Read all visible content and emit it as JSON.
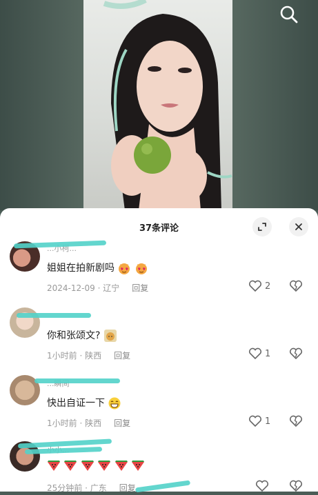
{
  "video": {
    "search_icon": "search-icon"
  },
  "comments_panel": {
    "title": "37条评论",
    "expand_icon": "expand-icon",
    "close_icon": "close-icon",
    "comments": [
      {
        "username": "...小柯...",
        "text": "姐姐在拍新剧吗",
        "emoji": [
          "heart-eyes-cat",
          "heart-eyes-cat"
        ],
        "time": "2024-12-09",
        "location": "辽宁",
        "reply": "回复",
        "likes": "2"
      },
      {
        "username": "",
        "text": "你和张颂文?",
        "emoji": [
          "smug-cat"
        ],
        "time": "1小时前",
        "location": "陕西",
        "reply": "回复",
        "likes": "1"
      },
      {
        "username": "...瞬间",
        "text": "快出自证一下",
        "emoji": [
          "grinning-face"
        ],
        "time": "1小时前",
        "location": "陕西",
        "reply": "回复",
        "likes": "1"
      },
      {
        "username": "小小...",
        "text": "",
        "emoji": [
          "watermelon",
          "watermelon",
          "watermelon",
          "watermelon",
          "watermelon",
          "watermelon"
        ],
        "time": "25分钟前",
        "location": "广东",
        "reply": "回复",
        "likes": ""
      }
    ]
  },
  "colors": {
    "streak": "#52d2c9",
    "bg_green": "#56675f"
  }
}
